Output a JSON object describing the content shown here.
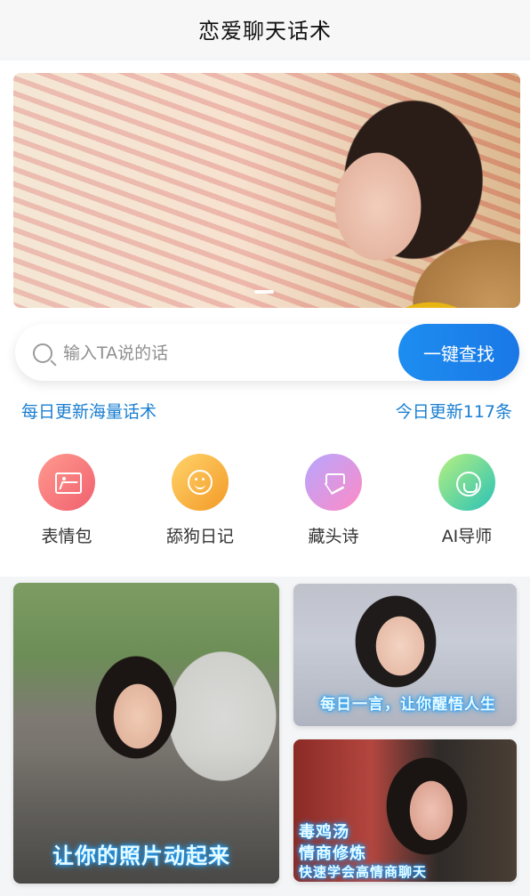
{
  "header": {
    "title": "恋爱聊天话术"
  },
  "banner": {
    "alt": ""
  },
  "search": {
    "placeholder": "输入TA说的话",
    "button_label": "一键查找"
  },
  "info": {
    "left_text": "每日更新海量话术",
    "right_text": "今日更新117条"
  },
  "features": [
    {
      "label": "表情包",
      "icon": "image-icon"
    },
    {
      "label": "舔狗日记",
      "icon": "smile-icon"
    },
    {
      "label": "藏头诗",
      "icon": "gem-icon"
    },
    {
      "label": "AI导师",
      "icon": "headset-icon"
    }
  ],
  "cards": [
    {
      "caption": "让你的照片动起来"
    },
    {
      "caption": "每日一言，让你醒悟人生"
    },
    {
      "caption_lines": [
        "毒鸡汤",
        "情商修炼",
        "快速学会高情商聊天"
      ]
    }
  ]
}
